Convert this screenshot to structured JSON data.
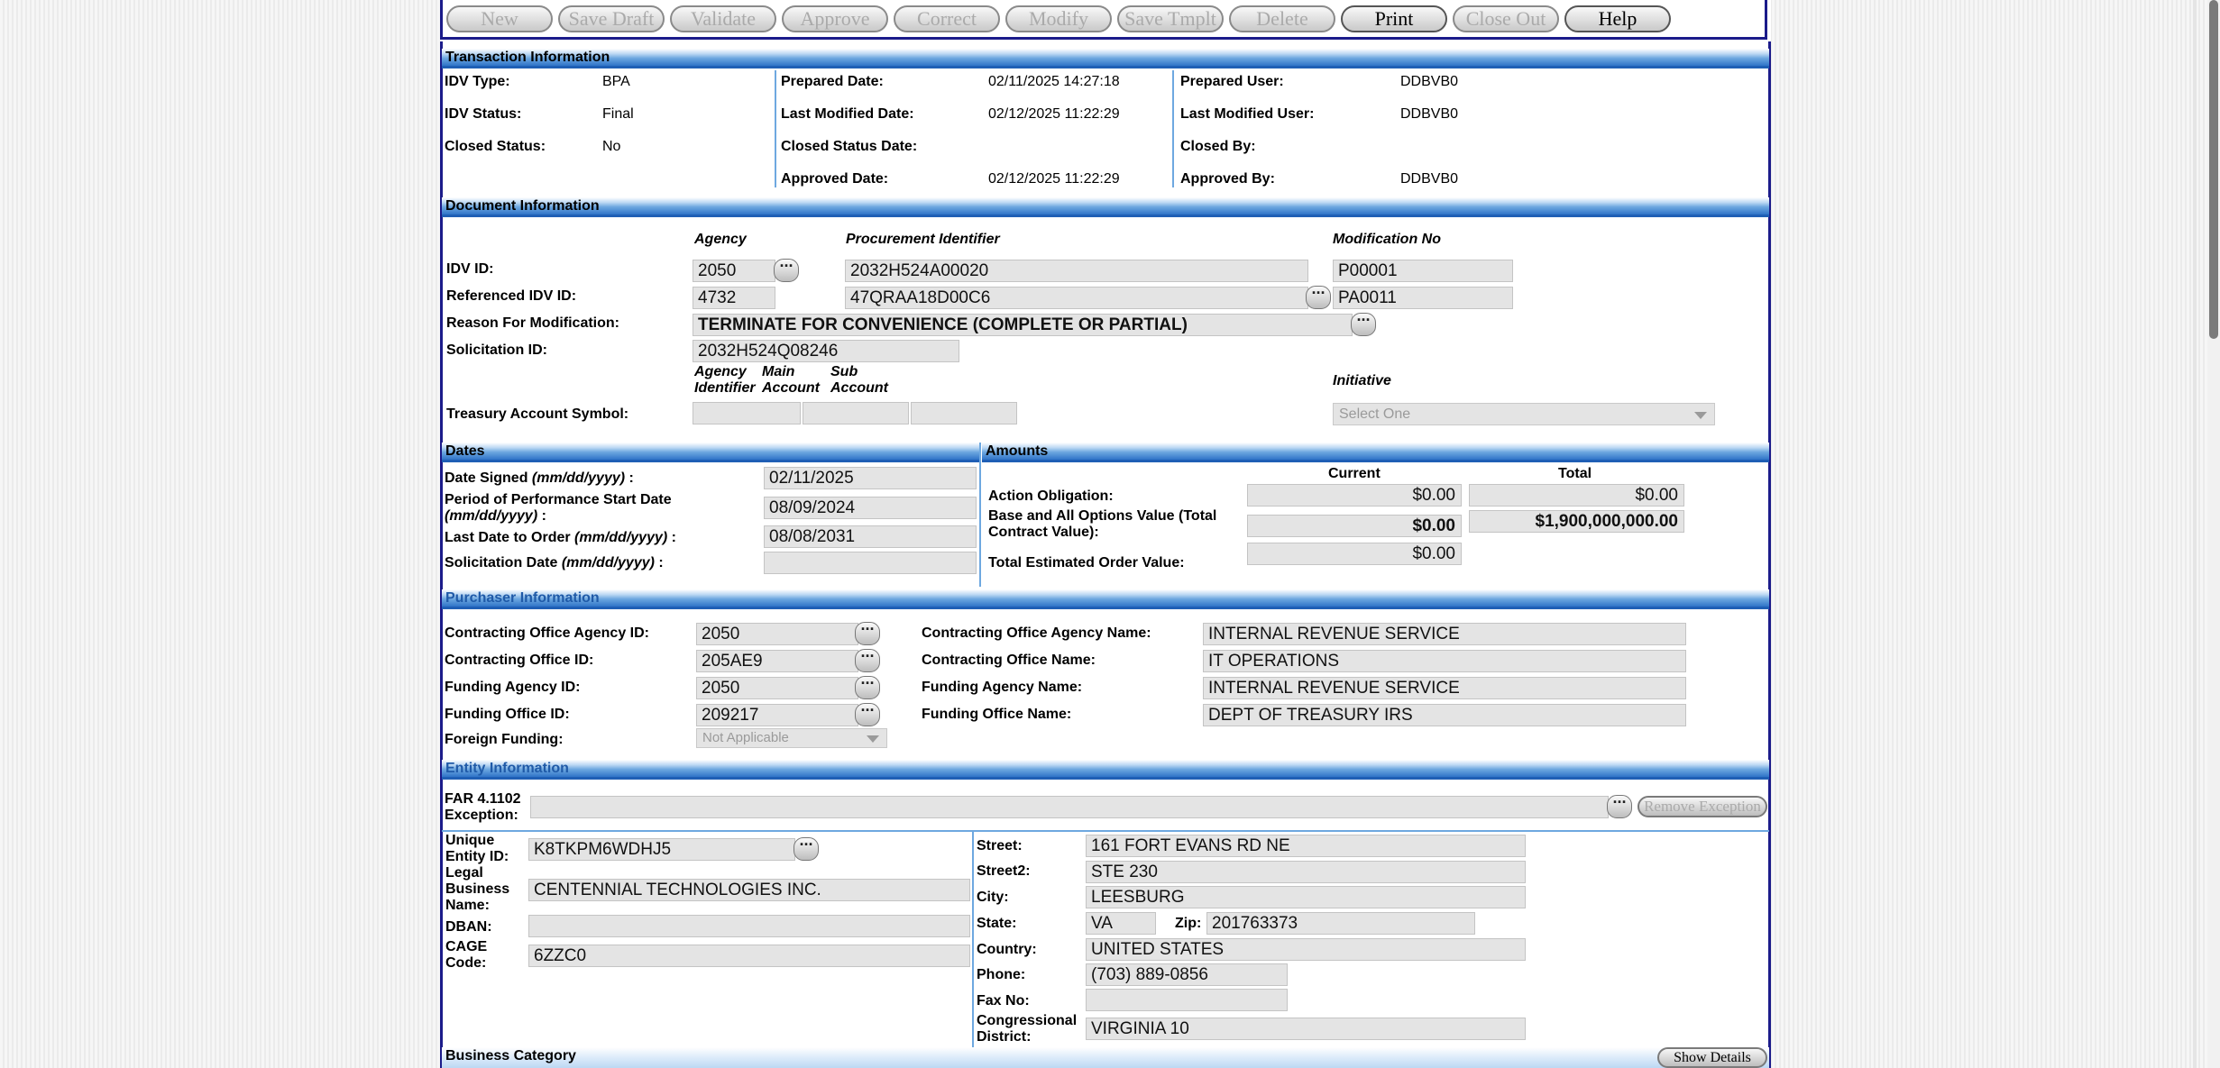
{
  "toolbar": {
    "buttons": [
      {
        "label": "New",
        "enabled": false
      },
      {
        "label": "Save Draft",
        "enabled": false
      },
      {
        "label": "Validate",
        "enabled": false
      },
      {
        "label": "Approve",
        "enabled": false
      },
      {
        "label": "Correct",
        "enabled": false
      },
      {
        "label": "Modify",
        "enabled": false
      },
      {
        "label": "Save Tmplt",
        "enabled": false
      },
      {
        "label": "Delete",
        "enabled": false
      },
      {
        "label": "Print",
        "enabled": true
      },
      {
        "label": "Close Out",
        "enabled": false
      },
      {
        "label": "Help",
        "enabled": true
      }
    ]
  },
  "transaction": {
    "title": "Transaction Information",
    "idv_type_label": "IDV Type:",
    "idv_type": "BPA",
    "idv_status_label": "IDV Status:",
    "idv_status": "Final",
    "closed_status_label": "Closed Status:",
    "closed_status": "No",
    "prepared_date_label": "Prepared Date:",
    "prepared_date": "02/11/2025 14:27:18",
    "last_modified_date_label": "Last Modified Date:",
    "last_modified_date": "02/12/2025 11:22:29",
    "closed_status_date_label": "Closed Status Date:",
    "closed_status_date": "",
    "approved_date_label": "Approved Date:",
    "approved_date": "02/12/2025 11:22:29",
    "prepared_user_label": "Prepared User:",
    "prepared_user": "DDBVB0",
    "last_modified_user_label": "Last Modified User:",
    "last_modified_user": "DDBVB0",
    "closed_by_label": "Closed By:",
    "closed_by": "",
    "approved_by_label": "Approved By:",
    "approved_by": "DDBVB0"
  },
  "document": {
    "title": "Document Information",
    "col_agency": "Agency",
    "col_proc_id": "Procurement Identifier",
    "col_mod_no": "Modification No",
    "idv_id_label": "IDV ID:",
    "idv_agency": "2050",
    "idv_proc_id": "2032H524A00020",
    "idv_mod_no": "P00001",
    "ref_idv_label": "Referenced IDV ID:",
    "ref_agency": "4732",
    "ref_proc_id": "47QRAA18D00C6",
    "ref_mod_no": "PA0011",
    "reason_label": "Reason For Modification:",
    "reason": "TERMINATE FOR CONVENIENCE (COMPLETE OR PARTIAL)",
    "solicitation_label": "Solicitation ID:",
    "solicitation_id": "2032H524Q08246",
    "tas_col_agency_1": "Agency",
    "tas_col_agency_2": "Identifier",
    "tas_col_main_1": "Main",
    "tas_col_main_2": "Account",
    "tas_col_sub_1": "Sub",
    "tas_col_sub_2": "Account",
    "initiative_label": "Initiative",
    "tas_label": "Treasury Account Symbol:",
    "initiative_placeholder": "Select One"
  },
  "dates": {
    "title": "Dates",
    "date_signed_label": "Date Signed",
    "date_signed_fmt": "(mm/dd/yyyy)",
    "date_signed_colon": " :",
    "date_signed": "02/11/2025",
    "pop_label": "Period of Performance Start Date",
    "pop_fmt": "(mm/dd/yyyy)",
    "pop_colon": " :",
    "pop_start": "08/09/2024",
    "last_order_label": "Last Date to Order",
    "last_order_fmt": "(mm/dd/yyyy)",
    "last_order_colon": " :",
    "last_order": "08/08/2031",
    "sol_date_label": "Solicitation Date",
    "sol_date_fmt": "(mm/dd/yyyy)",
    "sol_date_colon": " :",
    "sol_date": ""
  },
  "amounts": {
    "title": "Amounts",
    "col_current": "Current",
    "col_total": "Total",
    "action_obligation_label": "Action Obligation:",
    "action_obligation_current": "$0.00",
    "action_obligation_total": "$0.00",
    "base_options_label_1": "Base and All Options Value (Total",
    "base_options_label_2": "Contract Value):",
    "base_options_current": "$0.00",
    "base_options_total": "$1,900,000,000.00",
    "total_est_label": "Total Estimated Order Value:",
    "total_est_current": "$0.00"
  },
  "purchaser": {
    "title": "Purchaser Information",
    "co_agency_id_label": "Contracting Office Agency ID:",
    "co_agency_id": "2050",
    "co_id_label": "Contracting Office ID:",
    "co_id": "205AE9",
    "funding_agency_id_label": "Funding Agency ID:",
    "funding_agency_id": "2050",
    "funding_office_id_label": "Funding Office ID:",
    "funding_office_id": "209217",
    "foreign_funding_label": "Foreign Funding:",
    "foreign_funding": "Not Applicable",
    "co_agency_name_label": "Contracting Office Agency Name:",
    "co_agency_name": "INTERNAL REVENUE SERVICE",
    "co_name_label": "Contracting Office Name:",
    "co_name": "IT OPERATIONS",
    "funding_agency_name_label": "Funding Agency Name:",
    "funding_agency_name": "INTERNAL REVENUE SERVICE",
    "funding_office_name_label": "Funding Office Name:",
    "funding_office_name": "DEPT OF TREASURY  IRS"
  },
  "entity": {
    "title": "Entity Information",
    "far_label_1": "FAR 4.1102",
    "far_label_2": "Exception:",
    "far_value": "",
    "remove_exception": "Remove Exception",
    "uei_label_1": "Unique",
    "uei_label_2": "Entity ID:",
    "uei": "K8TKPM6WDHJ5",
    "lbn_label_1": "Legal",
    "lbn_label_2": "Business",
    "lbn_label_3": "Name:",
    "lbn": "CENTENNIAL TECHNOLOGIES INC.",
    "dban_label": "DBAN:",
    "dban": "",
    "cage_label_1": "CAGE",
    "cage_label_2": "Code:",
    "cage": "6ZZC0",
    "street_label": "Street:",
    "street": "161 FORT EVANS RD NE",
    "street2_label": "Street2:",
    "street2": "STE 230",
    "city_label": "City:",
    "city": "LEESBURG",
    "state_label": "State:",
    "state": "VA",
    "zip_label": "Zip:",
    "zip": "201763373",
    "country_label": "Country:",
    "country": "UNITED STATES",
    "phone_label": "Phone:",
    "phone": "(703) 889-0856",
    "fax_label": "Fax No:",
    "fax": "",
    "cong_label_1": "Congressional",
    "cong_label_2": "District:",
    "cong": "VIRGINIA 10"
  },
  "business_category": {
    "title": "Business Category",
    "show_details": "Show Details"
  },
  "dots_glyph": "···"
}
